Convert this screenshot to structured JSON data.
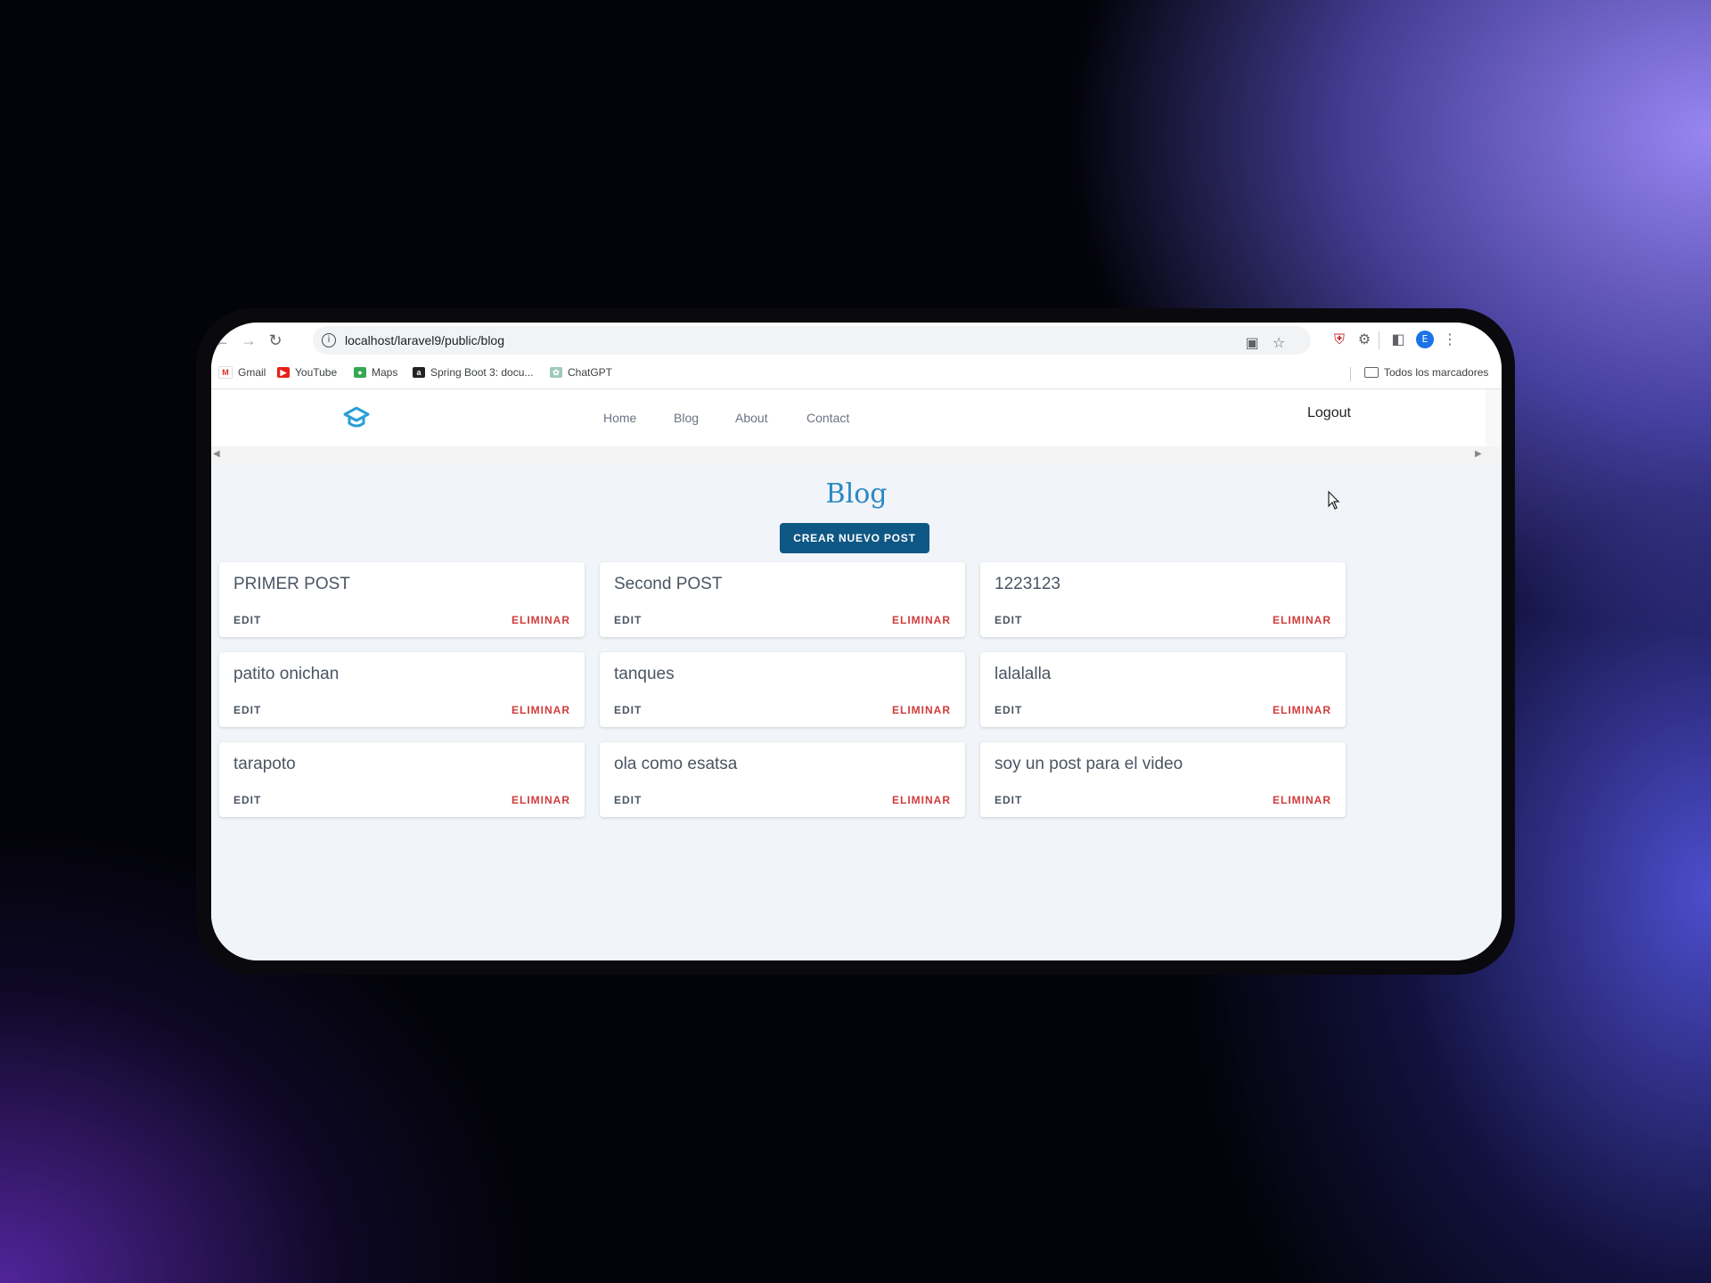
{
  "browser": {
    "url": "localhost/laravel9/public/blog",
    "bookmarks": [
      {
        "label": "Gmail",
        "icon": "gmail-icon"
      },
      {
        "label": "YouTube",
        "icon": "youtube-icon"
      },
      {
        "label": "Maps",
        "icon": "maps-icon"
      },
      {
        "label": "Spring Boot 3: docu...",
        "icon": "spring-icon"
      },
      {
        "label": "ChatGPT",
        "icon": "chatgpt-icon"
      }
    ],
    "all_bookmarks": "Todos los marcadores",
    "profile_initial": "E"
  },
  "nav": {
    "links": [
      "Home",
      "Blog",
      "About",
      "Contact"
    ],
    "logout": "Logout"
  },
  "blog": {
    "title": "Blog",
    "create_button": "CREAR NUEVO POST",
    "edit_label": "EDIT",
    "delete_label": "ELIMINAR",
    "posts": [
      "PRIMER POST",
      "Second POST",
      "1223123",
      "patito onichan",
      "tanques",
      "lalalalla",
      "tarapoto",
      "ola como esatsa",
      "soy un post para el video"
    ]
  },
  "colors": {
    "accent": "#2a88c4",
    "button": "#0f5784",
    "delete": "#d03b3b",
    "page_bg": "#f1f4f8"
  }
}
